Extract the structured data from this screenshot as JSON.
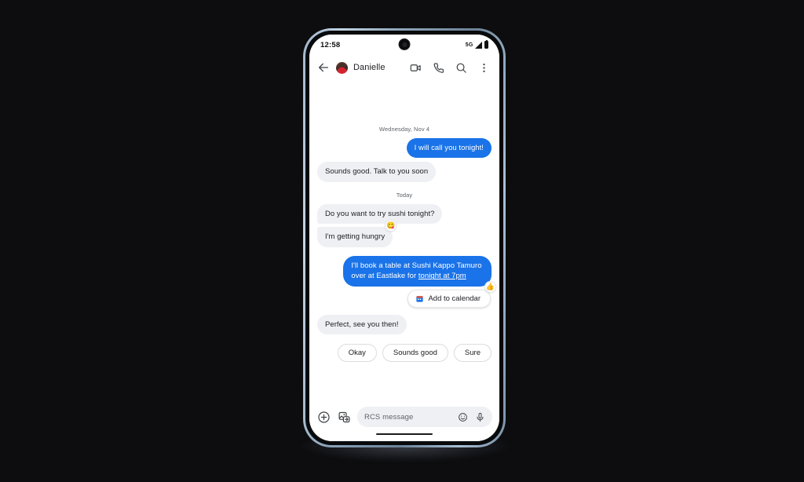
{
  "status_bar": {
    "time": "12:58",
    "network": "5G",
    "signal_icon": "signal-bars-icon",
    "battery_icon": "battery-full-icon"
  },
  "app_bar": {
    "back_icon": "back-arrow-icon",
    "avatar": "contact-avatar",
    "contact_name": "Danielle",
    "actions": [
      {
        "name": "video-call-icon",
        "label": "Video call"
      },
      {
        "name": "voice-call-icon",
        "label": "Call"
      },
      {
        "name": "search-icon",
        "label": "Search"
      },
      {
        "name": "overflow-menu-icon",
        "label": "More options"
      }
    ]
  },
  "thread": {
    "separator_1": "Wednesday, Nov 4",
    "separator_2": "Today",
    "messages": [
      {
        "id": "m1",
        "side": "out",
        "text": "I will call you tonight!"
      },
      {
        "id": "m2",
        "side": "in",
        "text": "Sounds good. Talk to you soon"
      },
      {
        "id": "m3",
        "side": "in",
        "text": "Do you want to try sushi tonight?"
      },
      {
        "id": "m4",
        "side": "in",
        "text": "I'm getting hungry"
      },
      {
        "id": "m5",
        "side": "out",
        "text_part1": "I'll book a table at Sushi Kappo Tamuro over at Eastlake for ",
        "link_text": "tonight at 7pm"
      },
      {
        "id": "m6",
        "side": "in",
        "text": "Perfect, see you then!"
      }
    ],
    "reactions": {
      "yum": "😋",
      "thumbs_up": "👍"
    },
    "calendar_chip": {
      "icon": "calendar-icon",
      "label": "Add to calendar"
    }
  },
  "suggestions": [
    {
      "label": "Okay"
    },
    {
      "label": "Sounds good"
    },
    {
      "label": "Sure"
    }
  ],
  "composer": {
    "plus_icon": "plus-circle-icon",
    "gallery_icon": "gallery-image-icon",
    "placeholder": "RCS message",
    "emoji_icon": "emoji-smiley-icon",
    "mic_icon": "microphone-icon"
  },
  "colors": {
    "outgoing_bubble": "#1a73e8",
    "incoming_bubble": "#eef0f4",
    "accent_blue": "#1a73e8",
    "page_background": "#0d0d0f"
  }
}
